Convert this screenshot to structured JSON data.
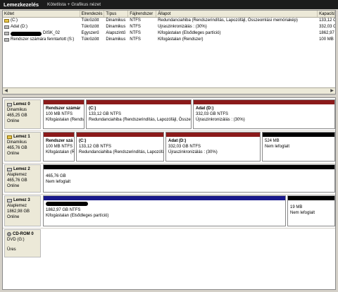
{
  "titlebar": {
    "title": "Lemezkezelés",
    "subtitle": "Kötetlista + Grafikus nézet"
  },
  "volume_list": {
    "columns": [
      "Kötet",
      "Elrendezés",
      "Típus",
      "Fájlrendszer",
      "Állapot",
      "Kapacitás"
    ],
    "rows": [
      {
        "volume": "(C:)",
        "layout": "Tükrözött",
        "type": "Dinamikus",
        "fs": "NTFS",
        "status": "Redundanciahiba (Rendszerindítás, Lapozófájl, Összeomlási memóriakép)",
        "capacity": "133,12 GB",
        "icon": "system-drive-icon"
      },
      {
        "volume": "Adat (D:)",
        "layout": "Tükrözött",
        "type": "Dinamikus",
        "fs": "NTFS",
        "status": "Újraszinkronizálás : (30%)",
        "capacity": "332,03 GB",
        "icon": "drive-icon"
      },
      {
        "volume": "DISK_02",
        "layout": "Egyszerű",
        "type": "Alapszintű",
        "fs": "NTFS",
        "status": "Kifogástalan (Elsődleges partíció)",
        "capacity": "1862,97 G",
        "icon": "drive-icon"
      },
      {
        "volume": "Rendszer számára fenntartott (S:)",
        "layout": "Tükrözött",
        "type": "Dinamikus",
        "fs": "NTFS",
        "status": "Kifogástalan (Rendszer)",
        "capacity": "100 MB",
        "icon": "drive-icon"
      }
    ]
  },
  "disks": [
    {
      "name": "Lemez 0",
      "type": "Dinamikus",
      "size": "465,25 GB",
      "state": "Online",
      "icon": "disk-icon",
      "partitions": [
        {
          "label": "Rendszer számár",
          "size": "100 MB NTFS",
          "status": "Kifogástalan (Rends",
          "band": "red"
        },
        {
          "label": "(C:)",
          "size": "133,12 GB NTFS",
          "status": "Redundanciahiba (Rendszerindítás, Lapozófájl, Összeomi",
          "band": "red"
        },
        {
          "label": "Adat (D:)",
          "size": "332,03 GB NTFS",
          "status": "Újraszinkronizálás : (30%)",
          "band": "red"
        }
      ]
    },
    {
      "name": "Lemez 1",
      "type": "Dinamikus",
      "size": "465,76 GB",
      "state": "Online",
      "icon": "disk-icon",
      "partitions": [
        {
          "label": "Rendszer szá",
          "size": "100 MB NTFS",
          "status": "Kifogástalan (Re",
          "band": "red"
        },
        {
          "label": "(C:)",
          "size": "133,12 GB NTFS",
          "status": "Redundanciahiba (Rendszerindítás, Lapozófájl",
          "band": "red"
        },
        {
          "label": "Adat (D:)",
          "size": "332,03 GB NTFS",
          "status": "Újraszinkronizálás : (30%)",
          "band": "red"
        },
        {
          "label": "",
          "size": "524 MB",
          "status": "Nem lefoglalt",
          "band": "black"
        }
      ]
    },
    {
      "name": "Lemez 2",
      "type": "Alaplemez",
      "size": "465,76 GB",
      "state": "Online",
      "icon": "disk-icon",
      "partitions": [
        {
          "label": "",
          "size": "465,76 GB",
          "status": "Nem lefoglalt",
          "band": "black"
        }
      ]
    },
    {
      "name": "Lemez 3",
      "type": "Alaplemez",
      "size": "1862,98 GB",
      "state": "Online",
      "icon": "disk-icon",
      "partitions": [
        {
          "label": "",
          "size": "1862,97 GB NTFS",
          "status": "Kifogástalan (Elsődleges partíció)",
          "band": "navy"
        },
        {
          "label": "",
          "size": "19 MB",
          "status": "Nem lefoglalt",
          "band": "black"
        }
      ]
    },
    {
      "name": "CD-ROM 0",
      "type": "DVD (G:)",
      "size": "",
      "state": "Üres",
      "icon": "cdrom-icon",
      "partitions": []
    }
  ]
}
